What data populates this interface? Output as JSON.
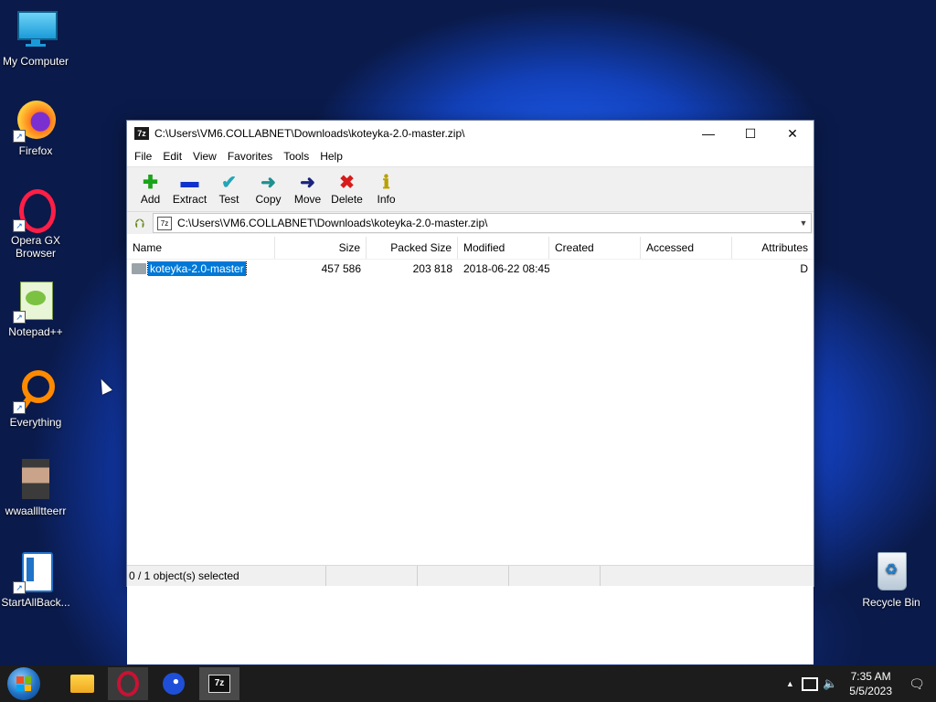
{
  "desktop": {
    "icons": [
      {
        "label": "My Computer"
      },
      {
        "label": "Firefox"
      },
      {
        "label": "Opera GX Browser"
      },
      {
        "label": "Notepad++"
      },
      {
        "label": "Everything"
      },
      {
        "label": "wwaallltteerr"
      },
      {
        "label": "StartAllBack..."
      },
      {
        "label": "Recycle Bin"
      }
    ]
  },
  "window": {
    "title": "C:\\Users\\VM6.COLLABNET\\Downloads\\koteyka-2.0-master.zip\\",
    "app_badge": "7z",
    "controls": {
      "minimize": "—",
      "maximize": "☐",
      "close": "✕"
    },
    "menu": [
      "File",
      "Edit",
      "View",
      "Favorites",
      "Tools",
      "Help"
    ],
    "toolbar": [
      {
        "label": "Add",
        "glyph": "✚",
        "color": "#1aa31a"
      },
      {
        "label": "Extract",
        "glyph": "▬",
        "color": "#1133cc"
      },
      {
        "label": "Test",
        "glyph": "✔",
        "color": "#22a5b8"
      },
      {
        "label": "Copy",
        "glyph": "➜",
        "color": "#1f8f8f"
      },
      {
        "label": "Move",
        "glyph": "➜",
        "color": "#1a237e"
      },
      {
        "label": "Delete",
        "glyph": "✖",
        "color": "#d81b1b"
      },
      {
        "label": "Info",
        "glyph": "ℹ",
        "color": "#b8a000"
      }
    ],
    "address": {
      "value": "C:\\Users\\VM6.COLLABNET\\Downloads\\koteyka-2.0-master.zip\\",
      "dropdown_glyph": "▼"
    },
    "columns": [
      "Name",
      "Size",
      "Packed Size",
      "Modified",
      "Created",
      "Accessed",
      "Attributes"
    ],
    "rows": [
      {
        "name": "koteyka-2.0-master",
        "size": "457 586",
        "packed": "203 818",
        "modified": "2018-06-22 08:45",
        "created": "",
        "accessed": "",
        "attributes": "D"
      }
    ],
    "status": {
      "selected": "0 / 1 object(s) selected",
      "seg2": "",
      "seg3": "",
      "seg4": ""
    }
  },
  "taskbar": {
    "tray_up": "▲",
    "time": "7:35 AM",
    "date": "5/5/2023",
    "active_app_badge": "7z"
  }
}
